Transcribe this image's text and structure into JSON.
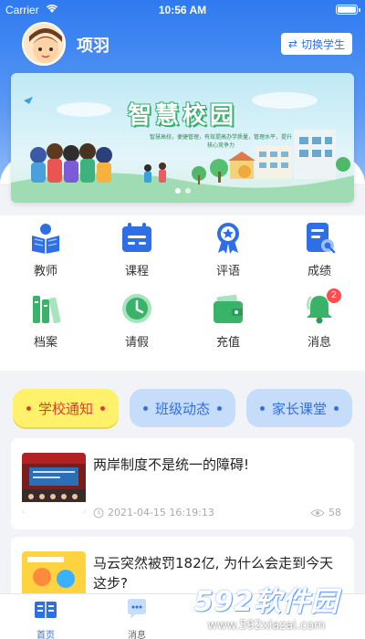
{
  "status_bar": {
    "carrier": "Carrier",
    "time": "10:56 AM"
  },
  "profile": {
    "name": "项羽",
    "switch_label": "切换学生"
  },
  "banner": {
    "title": "智慧校园",
    "subtitle": "智慧高校，便捷管理，有效提高办学质量，管理水平，提升核心竞争力"
  },
  "menu": {
    "items": [
      {
        "label": "教师",
        "icon": "teacher-book-icon",
        "color": "#2f6fe6"
      },
      {
        "label": "课程",
        "icon": "calendar-course-icon",
        "color": "#2f6fe6"
      },
      {
        "label": "评语",
        "icon": "award-medal-icon",
        "color": "#2f6fe6"
      },
      {
        "label": "成绩",
        "icon": "report-card-icon",
        "color": "#2f6fe6"
      },
      {
        "label": "档案",
        "icon": "archive-books-icon",
        "color": "#39b36a"
      },
      {
        "label": "请假",
        "icon": "clock-leave-icon",
        "color": "#39b36a"
      },
      {
        "label": "充值",
        "icon": "wallet-icon",
        "color": "#39b36a"
      },
      {
        "label": "消息",
        "icon": "bell-icon",
        "color": "#39b36a",
        "badge": "2"
      }
    ]
  },
  "tabs": [
    {
      "label": "学校通知",
      "active": true
    },
    {
      "label": "班级动态",
      "active": false
    },
    {
      "label": "家长课堂",
      "active": false
    }
  ],
  "news": [
    {
      "title": "两岸制度不是统一的障碍!",
      "time": "2021-04-15 16:19:13",
      "views": "58"
    },
    {
      "title": "马云突然被罚182亿, 为什么会走到今天这步?",
      "time": "",
      "views": ""
    }
  ],
  "tabbar": {
    "items": [
      {
        "label": "首页",
        "active": true
      },
      {
        "label": "消息",
        "active": false
      }
    ]
  },
  "watermark": {
    "brand": "592软件园",
    "url": "www.592xiazai.com"
  },
  "colors": {
    "primary": "#2f6fe6",
    "green": "#39b36a",
    "badge": "#ff4d4d",
    "notice_tab": "#fff16a"
  }
}
